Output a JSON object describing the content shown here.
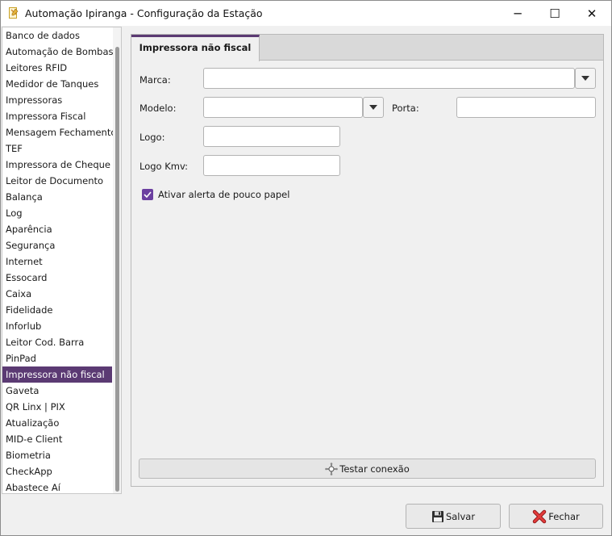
{
  "window": {
    "title": "Automação Ipiranga - Configuração da Estação",
    "app_icon": "file-pencil-icon",
    "controls": {
      "minimize": "─",
      "maximize": "☐",
      "close": "✕"
    }
  },
  "sidebar": {
    "selected_index": 21,
    "accent": "#5b3a73",
    "items": [
      "Banco de dados",
      "Automação de Bombas",
      "Leitores RFID",
      "Medidor de Tanques",
      "Impressoras",
      "Impressora Fiscal",
      "Mensagem Fechamento",
      "TEF",
      "Impressora de Cheque",
      "Leitor de Documento",
      "Balança",
      "Log",
      "Aparência",
      "Segurança",
      "Internet",
      "Essocard",
      "Caixa",
      "Fidelidade",
      "Inforlub",
      "Leitor Cod. Barra",
      "PinPad",
      "Impressora não fiscal",
      "Gaveta",
      "QR Linx | PIX",
      "Atualização",
      "MID-e Client",
      "Biometria",
      "CheckApp",
      "Abastece Aí"
    ]
  },
  "tab": {
    "label": "Impressora não fiscal"
  },
  "form": {
    "marca_label": "Marca:",
    "marca_value": "",
    "modelo_label": "Modelo:",
    "modelo_value": "",
    "porta_label": "Porta:",
    "porta_value": "",
    "logo_label": "Logo:",
    "logo_value": "",
    "logo_kmv_label": "Logo Kmv:",
    "logo_kmv_value": "",
    "alerta_label": "Ativar alerta de pouco papel",
    "alerta_checked": true,
    "checkbox_color": "#6b3fa0"
  },
  "buttons": {
    "testar": "Testar conexão",
    "salvar": "Salvar",
    "fechar": "Fechar"
  }
}
